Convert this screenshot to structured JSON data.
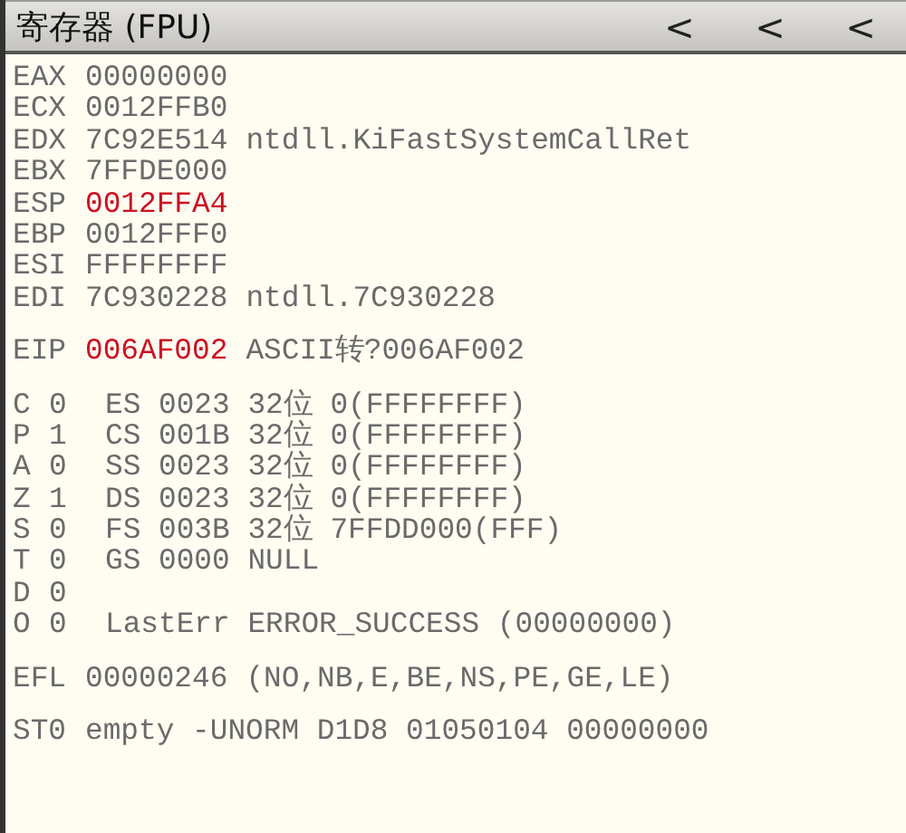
{
  "title": "寄存器 (FPU)",
  "arrows": [
    "<",
    "<",
    "<"
  ],
  "registers": [
    {
      "name": "EAX",
      "value": "00000000",
      "changed": false
    },
    {
      "name": "ECX",
      "value": "0012FFB0",
      "changed": false
    },
    {
      "name": "EDX",
      "value": "7C92E514",
      "changed": false,
      "comment": "ntdll.KiFastSystemCallRet"
    },
    {
      "name": "EBX",
      "value": "7FFDE000",
      "changed": false
    },
    {
      "name": "ESP",
      "value": "0012FFA4",
      "changed": true
    },
    {
      "name": "EBP",
      "value": "0012FFF0",
      "changed": false
    },
    {
      "name": "ESI",
      "value": "FFFFFFFF",
      "changed": false
    },
    {
      "name": "EDI",
      "value": "7C930228",
      "changed": false,
      "comment": "ntdll.7C930228"
    }
  ],
  "eip": {
    "name": "EIP",
    "value": "006AF002",
    "changed": true,
    "comment": "ASCII转?006AF002"
  },
  "flags": [
    {
      "name": "C",
      "value": "0",
      "info": "ES 0023 32位 0(FFFFFFFF)"
    },
    {
      "name": "P",
      "value": "1",
      "info": "CS 001B 32位 0(FFFFFFFF)"
    },
    {
      "name": "A",
      "value": "0",
      "info": "SS 0023 32位 0(FFFFFFFF)"
    },
    {
      "name": "Z",
      "value": "1",
      "info": "DS 0023 32位 0(FFFFFFFF)"
    },
    {
      "name": "S",
      "value": "0",
      "info": "FS 003B 32位 7FFDD000(FFF)"
    },
    {
      "name": "T",
      "value": "0",
      "info": "GS 0000 NULL"
    },
    {
      "name": "D",
      "value": "0"
    },
    {
      "name": "O",
      "value": "0",
      "info": "LastErr ERROR_SUCCESS (00000000)"
    }
  ],
  "efl": {
    "name": "EFL",
    "value": "00000246",
    "changed": false,
    "comment": "(NO,NB,E,BE,NS,PE,GE,LE)"
  },
  "fpu": [
    {
      "name": "ST0",
      "value": "empty -UNORM D1D8 01050104 00000000",
      "changed": false
    }
  ]
}
